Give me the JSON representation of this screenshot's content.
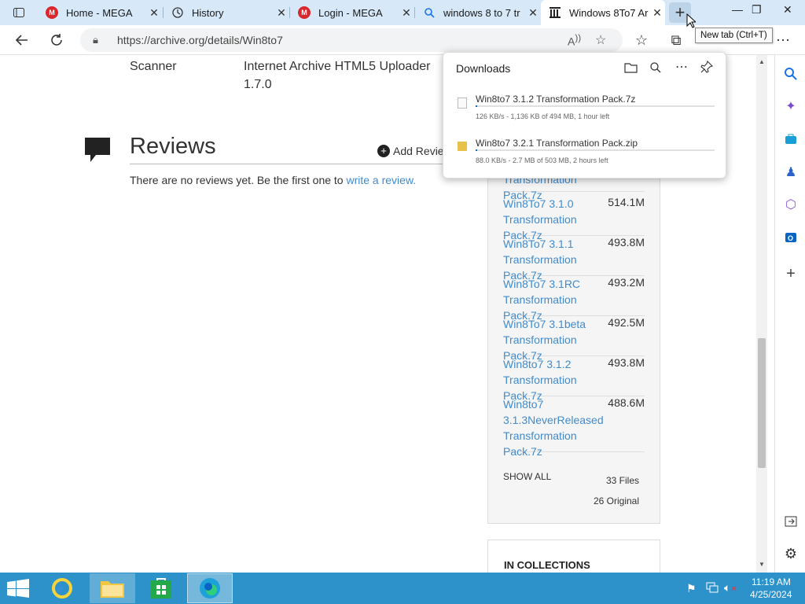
{
  "tabs": [
    {
      "title": "Home - MEGA",
      "icon": "mega-icon"
    },
    {
      "title": "History",
      "icon": "history-icon"
    },
    {
      "title": "Login - MEGA",
      "icon": "mega-icon"
    },
    {
      "title": "windows 8 to 7 tr",
      "icon": "search-icon"
    },
    {
      "title": "Windows 8To7 Ar",
      "icon": "archive-icon"
    }
  ],
  "tooltip": "New tab (Ctrl+T)",
  "address": {
    "url": "https://archive.org/details/Win8to7"
  },
  "page": {
    "scanner_label": "Scanner",
    "scanner_value_line1": "Internet Archive HTML5 Uploader",
    "scanner_value_line2": "1.7.0",
    "reviews_title": "Reviews",
    "add_review": "Add Revie",
    "no_reviews": "There are no reviews yet. Be the first one to ",
    "write_review": "write a review."
  },
  "files": [
    {
      "name_lines": [
        "Transformation Pack.7z"
      ],
      "size": ""
    },
    {
      "name_lines": [
        "Win8To7 3.1.0",
        "Transformation Pack.7z"
      ],
      "size": "514.1M"
    },
    {
      "name_lines": [
        "Win8To7 3.1.1",
        "Transformation Pack.7z"
      ],
      "size": "493.8M"
    },
    {
      "name_lines": [
        "Win8To7 3.1RC",
        "Transformation Pack.7z"
      ],
      "size": "493.2M"
    },
    {
      "name_lines": [
        "Win8To7 3.1beta",
        "Transformation Pack.7z"
      ],
      "size": "492.5M"
    },
    {
      "name_lines": [
        "Win8to7 3.1.2",
        "Transformation Pack.7z"
      ],
      "size": "493.8M"
    },
    {
      "name_lines": [
        "Win8to7",
        "3.1.3NeverReleased",
        "Transformation Pack.7z"
      ],
      "size": "488.6M"
    }
  ],
  "show_all": "SHOW ALL",
  "file_count": "33 Files",
  "original_count": "26 Original",
  "collections_title": "IN COLLECTIONS",
  "downloads": {
    "title": "Downloads",
    "items": [
      {
        "name": "Win8to7 3.1.2 Transformation Pack.7z",
        "status": "126 KB/s - 1,136 KB of 494 MB, 1 hour left",
        "progress": 0.0023
      },
      {
        "name": "Win8to7 3.2.1 Transformation Pack.zip",
        "status": "88.0 KB/s - 2.7 MB of 503 MB, 2 hours left",
        "progress": 0.0054
      }
    ]
  },
  "clock": {
    "time": "11:19 AM",
    "date": "4/25/2024"
  },
  "colors": {
    "tabbar": "#d7e9f8",
    "link": "#428bca",
    "taskbar": "#2c92c9",
    "accent": "#0f6cbd"
  }
}
